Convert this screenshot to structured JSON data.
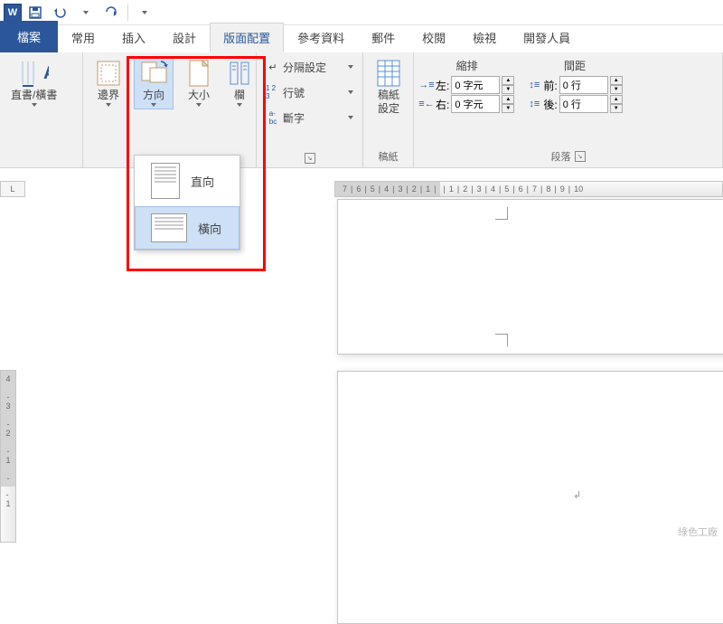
{
  "qat": {
    "save": "💾",
    "undo": "↶",
    "redo": "↻"
  },
  "tabs": {
    "file": "檔案",
    "items": [
      "常用",
      "插入",
      "設計",
      "版面配置",
      "參考資料",
      "郵件",
      "校閱",
      "檢視",
      "開發人員"
    ],
    "active_index": 3
  },
  "ribbon": {
    "text_direction": {
      "label": "直書/橫書"
    },
    "margins": {
      "label": "邊界"
    },
    "orientation": {
      "label": "方向"
    },
    "size": {
      "label": "大小"
    },
    "columns": {
      "label": "欄"
    },
    "breaks": {
      "label": "分隔設定"
    },
    "line_numbers": {
      "label": "行號"
    },
    "hyphenation": {
      "label": "斷字"
    },
    "page_setup_group": "稿紙",
    "稿紙_btn": {
      "label1": "稿紙",
      "label2": "設定"
    },
    "indent": {
      "header": "縮排",
      "left_label": "左:",
      "left_value": "0 字元",
      "right_label": "右:",
      "right_value": "0 字元"
    },
    "spacing": {
      "header": "間距",
      "before_label": "前:",
      "before_value": "0 行",
      "after_label": "後:",
      "after_value": "0 行"
    },
    "paragraph_group": "段落"
  },
  "orientation_menu": {
    "portrait": "直向",
    "landscape": "橫向"
  },
  "ruler": {
    "h_left": [
      "7",
      "6",
      "5",
      "4",
      "3",
      "2",
      "1"
    ],
    "h_right": [
      "1",
      "2",
      "3",
      "4",
      "5",
      "6",
      "7",
      "8",
      "9",
      "10"
    ],
    "v": [
      "4",
      "3",
      "2",
      "1",
      "1"
    ]
  },
  "watermark": "綠色工廠"
}
